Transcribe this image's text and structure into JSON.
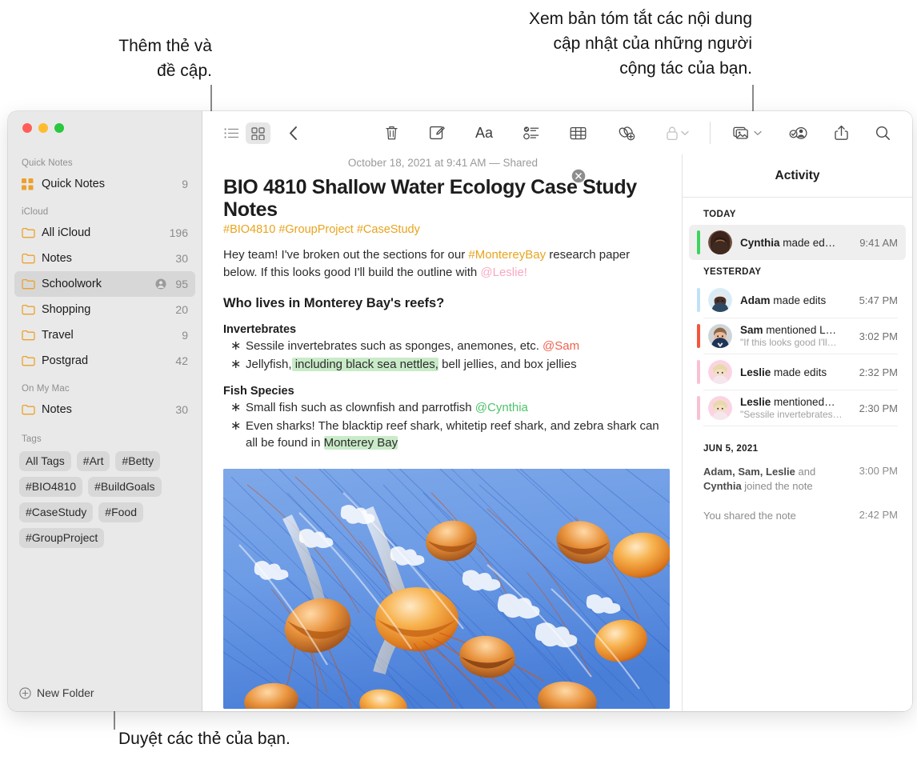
{
  "callouts": {
    "tags_mentions": "Thêm thẻ và\nđề cập.",
    "activity": "Xem bản tóm tắt các nội dung\ncập nhật của những người\ncộng tác của bạn.",
    "browse_tags": "Duyệt các thẻ của bạn."
  },
  "sidebar": {
    "sections": [
      {
        "title": "Quick Notes",
        "rows": [
          {
            "label": "Quick Notes",
            "count": "9",
            "icon": "quick-notes-icon",
            "shared": false,
            "selected": false
          }
        ]
      },
      {
        "title": "iCloud",
        "rows": [
          {
            "label": "All iCloud",
            "count": "196",
            "icon": "folder-icon",
            "shared": false,
            "selected": false
          },
          {
            "label": "Notes",
            "count": "30",
            "icon": "folder-icon",
            "shared": false,
            "selected": false
          },
          {
            "label": "Schoolwork",
            "count": "95",
            "icon": "folder-icon",
            "shared": true,
            "selected": true
          },
          {
            "label": "Shopping",
            "count": "20",
            "icon": "folder-icon",
            "shared": false,
            "selected": false
          },
          {
            "label": "Travel",
            "count": "9",
            "icon": "folder-icon",
            "shared": false,
            "selected": false
          },
          {
            "label": "Postgrad",
            "count": "42",
            "icon": "folder-icon",
            "shared": false,
            "selected": false
          }
        ]
      },
      {
        "title": "On My Mac",
        "rows": [
          {
            "label": "Notes",
            "count": "30",
            "icon": "folder-icon",
            "shared": false,
            "selected": false
          }
        ]
      }
    ],
    "tags_title": "Tags",
    "tags": [
      "All Tags",
      "#Art",
      "#Betty",
      "#BIO4810",
      "#BuildGoals",
      "#CaseStudy",
      "#Food",
      "#GroupProject"
    ],
    "new_folder_label": "New Folder"
  },
  "toolbar": {
    "left": [
      {
        "name": "list-view-icon",
        "label": "List View",
        "active": false
      },
      {
        "name": "gallery-view-icon",
        "label": "Gallery View",
        "active": true
      },
      {
        "name": "back-chevron-icon",
        "label": "Back",
        "active": false
      }
    ],
    "middle": [
      {
        "name": "trash-icon",
        "label": "Delete Note"
      },
      {
        "name": "compose-icon",
        "label": "New Note"
      },
      {
        "name": "format-aa-icon",
        "label": "Format"
      },
      {
        "name": "checklist-icon",
        "label": "Checklist"
      },
      {
        "name": "table-icon",
        "label": "Table"
      },
      {
        "name": "add-link-icon",
        "label": "Add Link"
      },
      {
        "name": "lock-icon",
        "label": "Lock Note",
        "dimmed": true,
        "caret": true
      }
    ],
    "right": [
      {
        "name": "media-icon",
        "label": "Media",
        "caret": true
      },
      {
        "name": "collaborate-icon",
        "label": "Share Note"
      },
      {
        "name": "share-icon",
        "label": "Share"
      },
      {
        "name": "search-icon",
        "label": "Search"
      }
    ]
  },
  "note": {
    "date": "October 18, 2021 at 9:41 AM — Shared",
    "title": "BIO 4810 Shallow Water Ecology Case Study Notes",
    "tags": "#BIO4810 #GroupProject #CaseStudy",
    "intro": {
      "part1": "Hey team! I've broken out the sections for our ",
      "hashtag": "#MontereyBay",
      "part2": " research paper below. If this looks good I'll build the outline with ",
      "mention": "@Leslie!"
    },
    "heading": "Who lives in Monterey Bay's reefs?",
    "sections": [
      {
        "subheading": "Invertebrates",
        "bullets": [
          {
            "text": "Sessile invertebrates such as sponges, anemones, etc. ",
            "mention": "@Sam",
            "mention_color": "red"
          },
          {
            "pre": "Jellyfish,",
            "highlight": " including black sea nettles,",
            "post": " bell jellies, and box jellies"
          }
        ]
      },
      {
        "subheading": "Fish Species",
        "bullets": [
          {
            "text": "Small fish such as clownfish and parrotfish ",
            "mention": "@Cynthia",
            "mention_color": "green"
          },
          {
            "pre": "Even sharks! The blacktip reef shark, whitetip reef shark, and zebra shark can all be found in ",
            "highlight": "Monterey Bay",
            "post": ""
          }
        ]
      }
    ],
    "image_alt": "jellyfish-photo"
  },
  "activity": {
    "title": "Activity",
    "close_label": "Close",
    "groups": [
      {
        "title": "TODAY",
        "items": [
          {
            "actor": "Cynthia",
            "action": " made ed…",
            "sub": "",
            "time": "9:41 AM",
            "bar_color": "#3ed35f",
            "avatar": "cynthia",
            "highlight": true
          }
        ]
      },
      {
        "title": "YESTERDAY",
        "items": [
          {
            "actor": "Adam",
            "action": " made edits",
            "sub": "",
            "time": "5:47 PM",
            "bar_color": "#bfe3f5",
            "avatar": "adam",
            "highlight": false
          },
          {
            "actor": "Sam",
            "action": " mentioned L…",
            "sub": "\"If this looks good I'll…",
            "time": "3:02 PM",
            "bar_color": "#f4553c",
            "avatar": "sam",
            "highlight": false
          },
          {
            "actor": "Leslie",
            "action": " made edits",
            "sub": "",
            "time": "2:32 PM",
            "bar_color": "#f9c2d4",
            "avatar": "leslie",
            "highlight": false
          },
          {
            "actor": "Leslie",
            "action": " mentioned…",
            "sub": "\"Sessile invertebrates…",
            "time": "2:30 PM",
            "bar_color": "#f9c2d4",
            "avatar": "leslie",
            "highlight": false
          }
        ]
      }
    ],
    "older_group": {
      "title": "JUN 5, 2021",
      "items": [
        {
          "names": "Adam, Sam, Leslie",
          "mid": " and ",
          "names2": "Cynthia",
          "tail": " joined the note",
          "time": "3:00 PM"
        },
        {
          "plain": "You shared the note",
          "time": "2:42 PM"
        }
      ]
    }
  },
  "colors": {
    "accent_yellow": "#e8a41d",
    "mention_pink": "#f7a9c0",
    "mention_red": "#f0614e",
    "mention_green": "#4dc36a",
    "highlight_green": "#c9ebc8",
    "sidebar_bg": "#e9e9e9",
    "selected_row": "#d7d7d7"
  }
}
